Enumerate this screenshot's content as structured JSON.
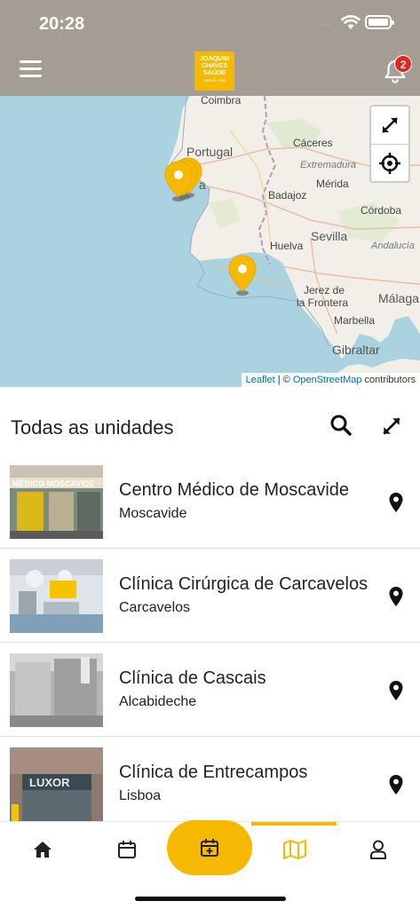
{
  "status_bar": {
    "time": "20:28",
    "signal": "····"
  },
  "header": {
    "logo_lines": [
      "JOAQUIM",
      "CHAVES",
      "SAÚDE"
    ],
    "logo_small": "DESDE 1959",
    "notification_count": "2",
    "brand_color": "#f7b900",
    "header_color": "#a39d93",
    "icons": {
      "menu": "hamburger-icon",
      "notifications": "bell-icon"
    }
  },
  "map": {
    "labels": {
      "coimbra": "Coimbra",
      "portugal": "Portugal",
      "caceres": "Cáceres",
      "extremadura": "Extremadura",
      "merida": "Mérida",
      "badajoz": "Badajoz",
      "cordoba": "Córdoba",
      "sevilla": "Sevilla",
      "huelva": "Huelva",
      "andalucia": "Andalucía",
      "jerez": "Jerez de",
      "jerez2": "la Frontera",
      "malaga": "Málaga",
      "marbella": "Marbella",
      "gibraltar": "Gibraltar",
      "lisboa_partial": "a"
    },
    "attribution": {
      "leaflet": "Leaflet",
      "sep": " | © ",
      "osm": "OpenStreetMap",
      "contrib": " contributors"
    },
    "icons": {
      "fullscreen": "expand-icon",
      "locate": "crosshair-icon",
      "marker": "map-pin-icon"
    }
  },
  "list": {
    "title": "Todas as unidades",
    "items": [
      {
        "name": "Centro Médico de Moscavide",
        "place": "Moscavide",
        "sign": "MÉDICO MOSCAVIDE"
      },
      {
        "name": "Clínica Cirúrgica de Carcavelos",
        "place": "Carcavelos"
      },
      {
        "name": "Clínica de Cascais",
        "place": "Alcabideche"
      },
      {
        "name": "Clínica de Entrecampos",
        "place": "Lisboa",
        "sign": "LUXOR"
      }
    ]
  },
  "bottom_nav": {
    "items": [
      "home-icon",
      "calendar-icon",
      "calendar-add-icon",
      "map-icon",
      "user-icon"
    ],
    "active": "map"
  }
}
